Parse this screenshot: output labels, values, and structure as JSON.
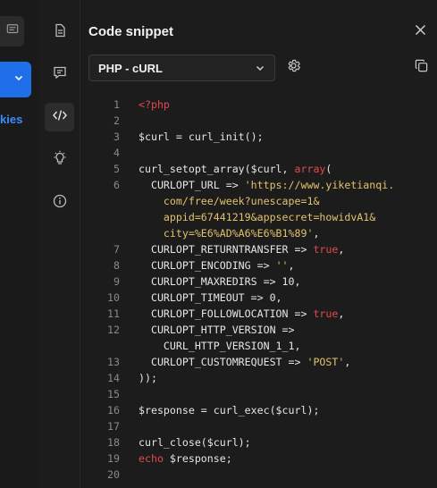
{
  "background_app": {
    "link_text": "kies"
  },
  "panel": {
    "title": "Code snippet",
    "language_select": "PHP - cURL"
  },
  "code": [
    {
      "n": "1",
      "parts": [
        {
          "t": "<?php",
          "c": "kw"
        }
      ]
    },
    {
      "n": "2",
      "parts": []
    },
    {
      "n": "3",
      "parts": [
        {
          "t": "$curl = curl_init();"
        }
      ]
    },
    {
      "n": "4",
      "parts": []
    },
    {
      "n": "5",
      "parts": [
        {
          "t": "curl_setopt_array($curl, "
        },
        {
          "t": "array",
          "c": "kw"
        },
        {
          "t": "("
        }
      ]
    },
    {
      "n": "6",
      "parts": [
        {
          "t": "  CURLOPT_URL => "
        },
        {
          "t": "'https://www.yiketianqi.",
          "c": "str"
        }
      ]
    },
    {
      "n": "",
      "parts": [
        {
          "t": "    com/free/week?unescape=1&",
          "c": "str"
        }
      ]
    },
    {
      "n": "",
      "parts": [
        {
          "t": "    appid=67441219&appsecret=howidvA1&",
          "c": "str"
        }
      ]
    },
    {
      "n": "",
      "parts": [
        {
          "t": "    city=%E6%AD%A6%E6%B1%89'",
          "c": "str"
        },
        {
          "t": ","
        }
      ]
    },
    {
      "n": "7",
      "parts": [
        {
          "t": "  CURLOPT_RETURNTRANSFER => "
        },
        {
          "t": "true",
          "c": "kw"
        },
        {
          "t": ","
        }
      ]
    },
    {
      "n": "8",
      "parts": [
        {
          "t": "  CURLOPT_ENCODING => "
        },
        {
          "t": "''",
          "c": "str"
        },
        {
          "t": ","
        }
      ]
    },
    {
      "n": "9",
      "parts": [
        {
          "t": "  CURLOPT_MAXREDIRS => 10,"
        }
      ]
    },
    {
      "n": "10",
      "parts": [
        {
          "t": "  CURLOPT_TIMEOUT => 0,"
        }
      ]
    },
    {
      "n": "11",
      "parts": [
        {
          "t": "  CURLOPT_FOLLOWLOCATION => "
        },
        {
          "t": "true",
          "c": "kw"
        },
        {
          "t": ","
        }
      ]
    },
    {
      "n": "12",
      "parts": [
        {
          "t": "  CURLOPT_HTTP_VERSION =>"
        }
      ]
    },
    {
      "n": "",
      "parts": [
        {
          "t": "    CURL_HTTP_VERSION_1_1,"
        }
      ]
    },
    {
      "n": "13",
      "parts": [
        {
          "t": "  CURLOPT_CUSTOMREQUEST => "
        },
        {
          "t": "'POST'",
          "c": "str"
        },
        {
          "t": ","
        }
      ]
    },
    {
      "n": "14",
      "parts": [
        {
          "t": "));"
        }
      ]
    },
    {
      "n": "15",
      "parts": []
    },
    {
      "n": "16",
      "parts": [
        {
          "t": "$response = curl_exec($curl);"
        }
      ]
    },
    {
      "n": "17",
      "parts": []
    },
    {
      "n": "18",
      "parts": [
        {
          "t": "curl_close($curl);"
        }
      ]
    },
    {
      "n": "19",
      "parts": [
        {
          "t": "echo",
          "c": "kw"
        },
        {
          "t": " $response;"
        }
      ]
    },
    {
      "n": "20",
      "parts": []
    }
  ]
}
